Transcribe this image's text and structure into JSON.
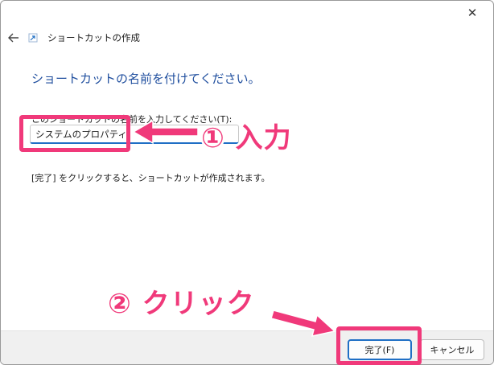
{
  "window": {
    "close_glyph": "✕"
  },
  "wizard": {
    "title": "ショートカットの作成",
    "heading": "ショートカットの名前を付けてください。",
    "field_label": "このショートカットの名前を入力してください(T):",
    "name_value": "システムのプロパティ",
    "info_text": "[完了] をクリックすると、ショートカットが作成されます。"
  },
  "footer": {
    "finish_label": "完了(F)",
    "cancel_label": "キャンセル"
  },
  "annotations": {
    "step1": "① 入力",
    "step2": "② クリック",
    "color": "#f0397a"
  },
  "colors": {
    "accent": "#1f6fc5",
    "heading": "#1f4e9e"
  }
}
